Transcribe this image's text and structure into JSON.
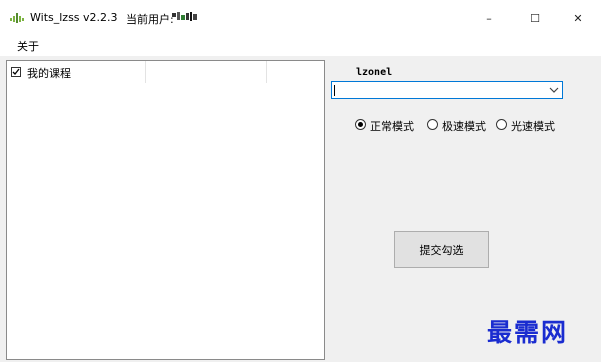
{
  "window": {
    "title": "Wits_lzss  v2.2.3",
    "user_prefix": "当前用户:",
    "controls": {
      "minimize": "–",
      "maximize": "☐",
      "close": "✕"
    }
  },
  "menu": {
    "items": [
      {
        "label": "关于"
      }
    ]
  },
  "course_tree": {
    "items": [
      {
        "label": "我的课程",
        "checked": true
      }
    ]
  },
  "account": {
    "username": "lzonel",
    "combo_value": ""
  },
  "mode": {
    "options": [
      {
        "label": "正常模式",
        "selected": true
      },
      {
        "label": "极速模式",
        "selected": false
      },
      {
        "label": "光速模式",
        "selected": false
      }
    ]
  },
  "actions": {
    "submit_label": "提交勾选"
  },
  "watermark": "最需网",
  "colors": {
    "accent": "#0078d7",
    "watermark": "#1a2cd0"
  }
}
